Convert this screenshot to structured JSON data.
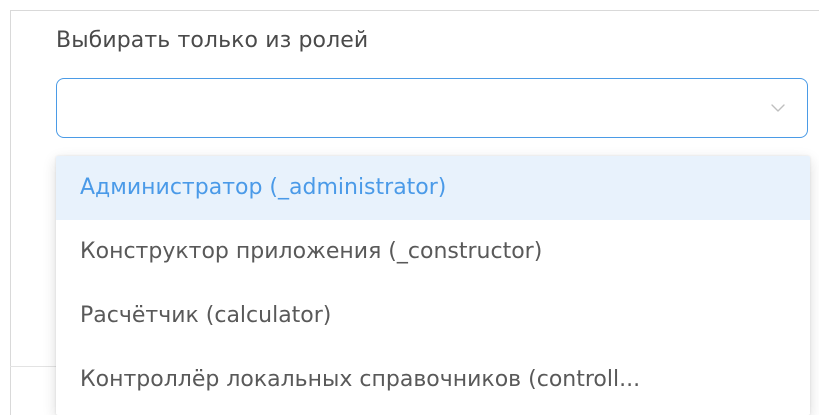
{
  "field": {
    "label": "Выбирать только из ролей",
    "value": ""
  },
  "dropdown": {
    "options": [
      {
        "label": "Администратор (_administrator)",
        "highlighted": true
      },
      {
        "label": "Конструктор приложения (_constructor)",
        "highlighted": false
      },
      {
        "label": "Расчётчик (calculator)",
        "highlighted": false
      },
      {
        "label": "Контроллёр локальных справочников (controll...",
        "highlighted": false
      }
    ]
  },
  "colors": {
    "accent": "#4a9ae8",
    "highlight_bg": "#e8f2fc",
    "text": "#595959"
  },
  "icons": {
    "select_chevron": "chevron-down-icon"
  }
}
